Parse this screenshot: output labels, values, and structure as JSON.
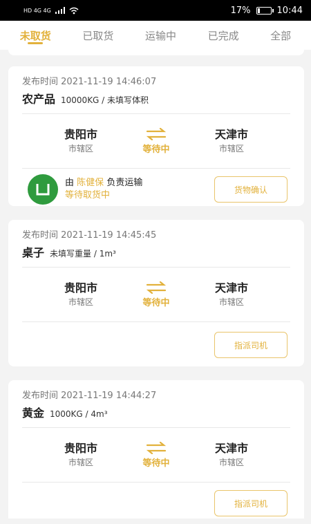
{
  "status_bar": {
    "left_text": "HD 4G 4G",
    "battery_percent": "17%",
    "battery_level": 0.17,
    "time": "10:44"
  },
  "tabs": [
    {
      "label": "未取货",
      "active": true
    },
    {
      "label": "已取货",
      "active": false
    },
    {
      "label": "运输中",
      "active": false
    },
    {
      "label": "已完成",
      "active": false
    },
    {
      "label": "全部",
      "active": false
    }
  ],
  "accent_color": "#e2b13b",
  "orders": [
    {
      "publish_label": "发布时间",
      "publish_time": "2021-11-19 14:46:07",
      "goods": "农产品",
      "spec": "10000KG / 未填写体积",
      "from_city": "贵阳市",
      "from_district": "市辖区",
      "status": "等待中",
      "to_city": "天津市",
      "to_district": "市辖区",
      "driver_prefix": "由",
      "driver_name": "陈健保",
      "driver_suffix": "负责运输",
      "driver_status": "等待取货中",
      "button": "货物确认"
    },
    {
      "publish_label": "发布时间",
      "publish_time": "2021-11-19 14:45:45",
      "goods": "桌子",
      "spec": "未填写重量 / 1m³",
      "from_city": "贵阳市",
      "from_district": "市辖区",
      "status": "等待中",
      "to_city": "天津市",
      "to_district": "市辖区",
      "button": "指派司机"
    },
    {
      "publish_label": "发布时间",
      "publish_time": "2021-11-19 14:44:27",
      "goods": "黄金",
      "spec": "1000KG / 4m³",
      "from_city": "贵阳市",
      "from_district": "市辖区",
      "status": "等待中",
      "to_city": "天津市",
      "to_district": "市辖区",
      "button": "指派司机"
    }
  ]
}
